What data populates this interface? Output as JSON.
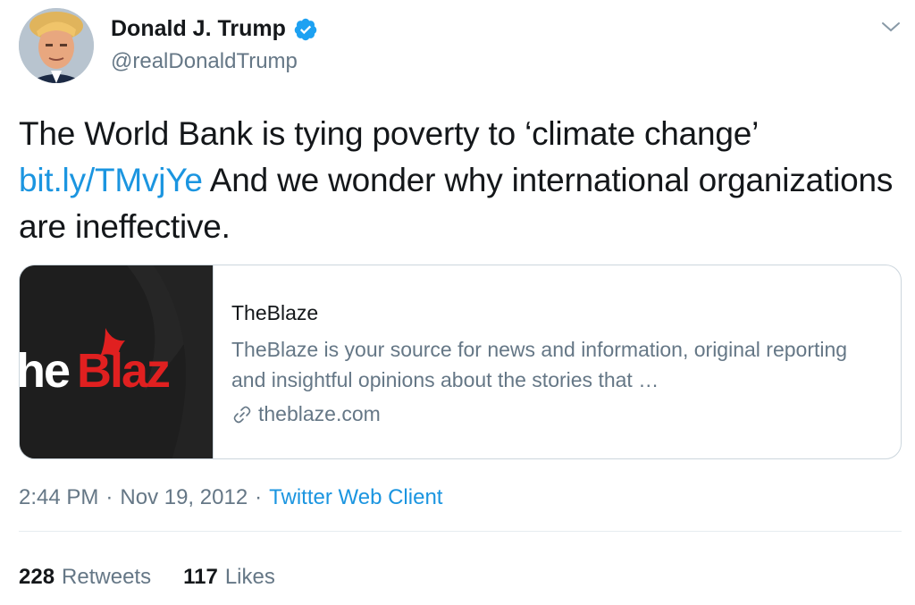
{
  "author": {
    "name": "Donald J. Trump",
    "handle": "@realDonaldTrump"
  },
  "tweet": {
    "text_before": "The World Bank is tying poverty to ‘climate change’ ",
    "link": "bit.ly/TMvjYe",
    "text_after": "  And we wonder why international organizations are ineffective."
  },
  "card": {
    "image_text": "heBlaz",
    "title": "TheBlaze",
    "description": "TheBlaze is your source for news and information, original reporting and insightful opinions about the stories that …",
    "domain": "theblaze.com"
  },
  "meta": {
    "time": "2:44 PM",
    "separator": "·",
    "date": "Nov 19, 2012",
    "source": "Twitter Web Client"
  },
  "stats": {
    "retweets_count": "228",
    "retweets_label": "Retweets",
    "likes_count": "117",
    "likes_label": "Likes"
  },
  "colors": {
    "accent": "#1b95e0",
    "secondary_text": "#657786",
    "blaze_red": "#e02020"
  }
}
